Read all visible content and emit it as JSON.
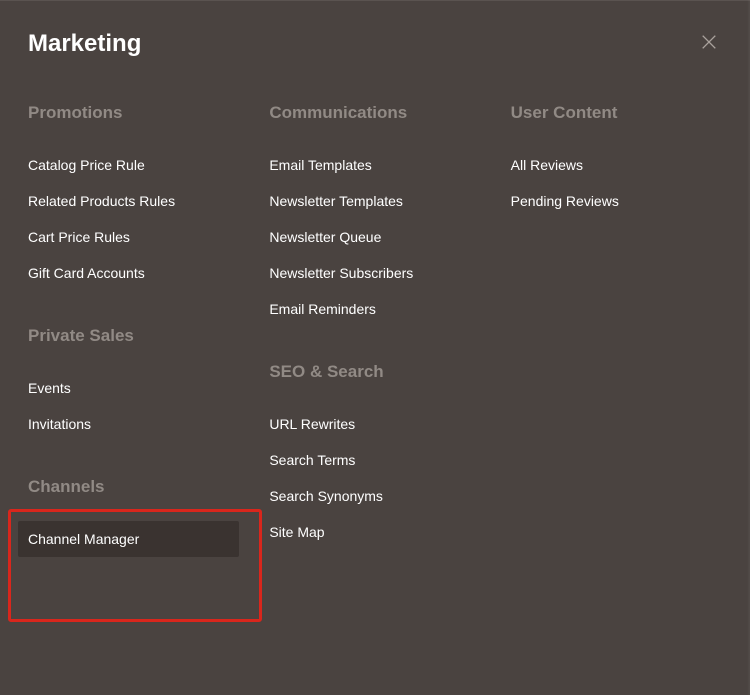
{
  "title": "Marketing",
  "columns": [
    {
      "sections": [
        {
          "heading": "Promotions",
          "items": [
            "Catalog Price Rule",
            "Related Products Rules",
            "Cart Price Rules",
            "Gift Card Accounts"
          ]
        },
        {
          "heading": "Private Sales",
          "items": [
            "Events",
            "Invitations"
          ]
        },
        {
          "heading": "Channels",
          "items": [
            "Channel Manager"
          ]
        }
      ]
    },
    {
      "sections": [
        {
          "heading": "Communications",
          "items": [
            "Email Templates",
            "Newsletter Templates",
            "Newsletter Queue",
            "Newsletter Subscribers",
            "Email Reminders"
          ]
        },
        {
          "heading": "SEO & Search",
          "items": [
            "URL Rewrites",
            "Search Terms",
            "Search Synonyms",
            "Site Map"
          ]
        }
      ]
    },
    {
      "sections": [
        {
          "heading": "User Content",
          "items": [
            "All Reviews",
            "Pending Reviews"
          ]
        }
      ]
    }
  ]
}
